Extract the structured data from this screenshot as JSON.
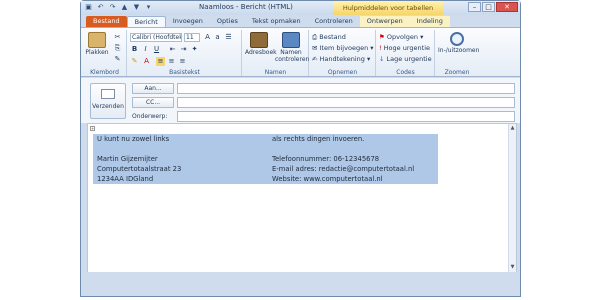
{
  "window": {
    "title": "Naamloos - Bericht (HTML)",
    "context_tools": "Hulpmiddelen voor tabellen",
    "controls": [
      "–",
      "□",
      "✕"
    ]
  },
  "quick_access_icons": [
    "save-icon",
    "undo-icon",
    "redo-icon",
    "up-icon",
    "down-icon",
    "dropdown-icon"
  ],
  "tabs": [
    {
      "label": "Bestand",
      "kind": "file"
    },
    {
      "label": "Bericht",
      "kind": "active"
    },
    {
      "label": "Invoegen",
      "kind": "normal"
    },
    {
      "label": "Opties",
      "kind": "normal"
    },
    {
      "label": "Tekst opmaken",
      "kind": "normal"
    },
    {
      "label": "Controleren",
      "kind": "normal"
    },
    {
      "label": "Ontwerpen",
      "kind": "ctx"
    },
    {
      "label": "Indeling",
      "kind": "ctx"
    }
  ],
  "ribbon": {
    "klembord": {
      "label": "Klembord",
      "paste": "Plakken"
    },
    "basistekst": {
      "label": "Basistekst",
      "font": "Calibri (Hoofdtekst)",
      "size": "11"
    },
    "namen": {
      "label": "Namen",
      "adresboek": "Adresboek",
      "namen_controleren": "Namen controleren"
    },
    "opnemen": {
      "label": "Opnemen",
      "items": [
        "Bestand",
        "Item bijvoegen",
        "Handtekening"
      ]
    },
    "codes": {
      "label": "Codes",
      "items": [
        "Opvolgen",
        "Hoge urgentie",
        "Lage urgentie"
      ]
    },
    "zoomen": {
      "label": "Zoomen",
      "button": "In-/uitzoomen"
    }
  },
  "header": {
    "send": "Verzenden",
    "to_button": "Aan...",
    "cc_button": "CC...",
    "subject_label": "Onderwerp:",
    "to_value": "",
    "cc_value": "",
    "subject_value": ""
  },
  "signature": {
    "rows": [
      [
        "U kunt nu zowel links",
        "als rechts dingen invoeren."
      ],
      [
        "",
        ""
      ],
      [
        "Martin Gijzemijter",
        "Telefoonnummer: 06-12345678"
      ],
      [
        "Computertotaalstraat 23",
        "E-mail adres: redactie@computertotaal.nl"
      ],
      [
        "1234AA IDGland",
        "Website: www.computertotaal.nl"
      ]
    ]
  },
  "colors": {
    "accent_file_tab": "#d85b1f",
    "table_highlight": "#b0c8e8",
    "ribbon_bg": "#e4ecf6"
  }
}
